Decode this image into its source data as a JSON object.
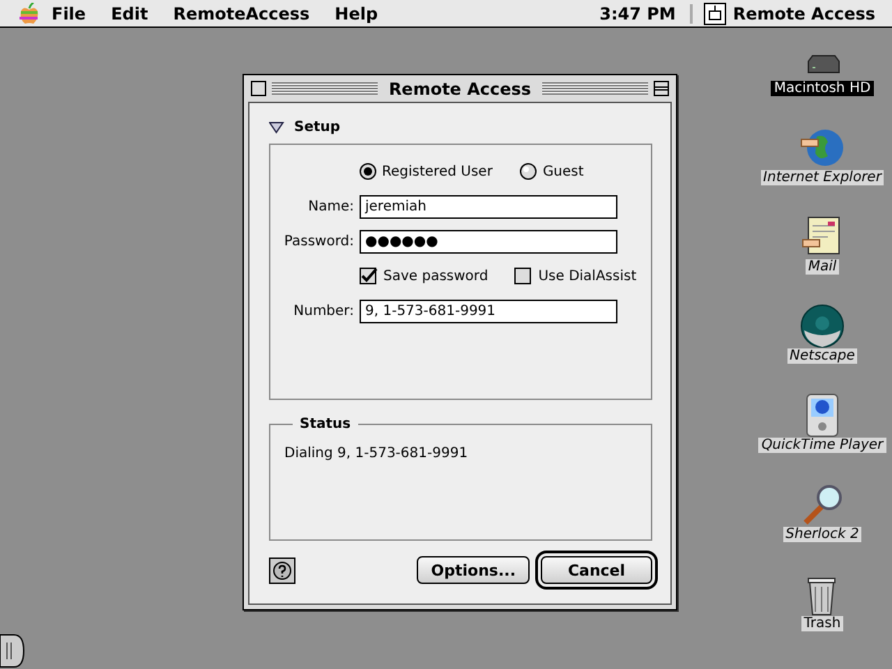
{
  "menubar": {
    "menus": [
      "File",
      "Edit",
      "RemoteAccess",
      "Help"
    ],
    "clock": "3:47 PM",
    "app_name": "Remote Access"
  },
  "window": {
    "title": "Remote Access",
    "setup": {
      "label": "Setup",
      "expanded": true,
      "user_types": [
        {
          "label": "Registered User",
          "selected": true
        },
        {
          "label": "Guest",
          "selected": false
        }
      ],
      "fields": [
        {
          "label": "Name:",
          "value": "jeremiah"
        },
        {
          "label": "Password:",
          "value": "●●●●●●"
        }
      ],
      "options": [
        {
          "label": "Save password",
          "checked": true
        },
        {
          "label": "Use DialAssist",
          "checked": false
        }
      ],
      "number": {
        "label": "Number:",
        "value": "9, 1-573-681-9991"
      }
    },
    "status": {
      "label": "Status",
      "message": "Dialing 9, 1-573-681-9991"
    },
    "buttons": [
      {
        "label": "Options...",
        "default": false
      },
      {
        "label": "Cancel",
        "default": true
      }
    ]
  },
  "desktop_icons": [
    {
      "label": "Macintosh HD",
      "kind": "disk",
      "alias": false,
      "selected": true
    },
    {
      "label": "Internet Explorer",
      "kind": "globe",
      "alias": true,
      "selected": false
    },
    {
      "label": "Mail",
      "kind": "mail",
      "alias": true,
      "selected": false
    },
    {
      "label": "Netscape",
      "kind": "wheel",
      "alias": true,
      "selected": false
    },
    {
      "label": "QuickTime Player",
      "kind": "player",
      "alias": true,
      "selected": false
    },
    {
      "label": "Sherlock 2",
      "kind": "magnifier",
      "alias": true,
      "selected": false
    },
    {
      "label": "Trash",
      "kind": "trash",
      "alias": false,
      "selected": false
    }
  ]
}
